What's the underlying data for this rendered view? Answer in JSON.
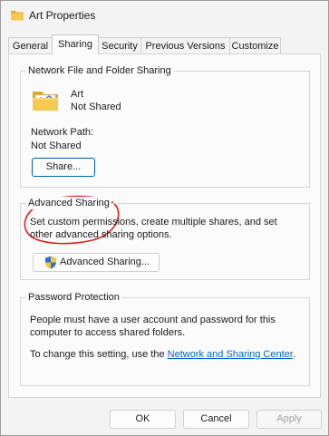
{
  "window": {
    "title": "Art Properties"
  },
  "tabs": [
    {
      "label": "General",
      "active": false
    },
    {
      "label": "Sharing",
      "active": true
    },
    {
      "label": "Security",
      "active": false
    },
    {
      "label": "Previous Versions",
      "active": false
    },
    {
      "label": "Customize",
      "active": false
    }
  ],
  "network_sharing": {
    "group_title": "Network File and Folder Sharing",
    "folder_name": "Art",
    "folder_status": "Not Shared",
    "network_path_label": "Network Path:",
    "network_path_value": "Not Shared",
    "share_button": "Share..."
  },
  "advanced_sharing": {
    "group_title": "Advanced Sharing",
    "description": "Set custom permissions, create multiple shares, and set other advanced sharing options.",
    "button": "Advanced Sharing..."
  },
  "password_protection": {
    "group_title": "Password Protection",
    "description": "People must have a user account and password for this computer to access shared folders.",
    "change_text": "To change this setting, use the ",
    "link": "Network and Sharing Center",
    "link_suffix": "."
  },
  "footer": {
    "ok": "OK",
    "cancel": "Cancel",
    "apply": "Apply"
  },
  "colors": {
    "accent": "#005fb8",
    "link": "#0066cc",
    "annotation": "#e0201b",
    "folder": "#f2c14e"
  },
  "icons": {
    "title_icon": "folder-icon",
    "folder_icon": "folder-icon",
    "advanced_button_icon": "uac-shield-icon"
  }
}
